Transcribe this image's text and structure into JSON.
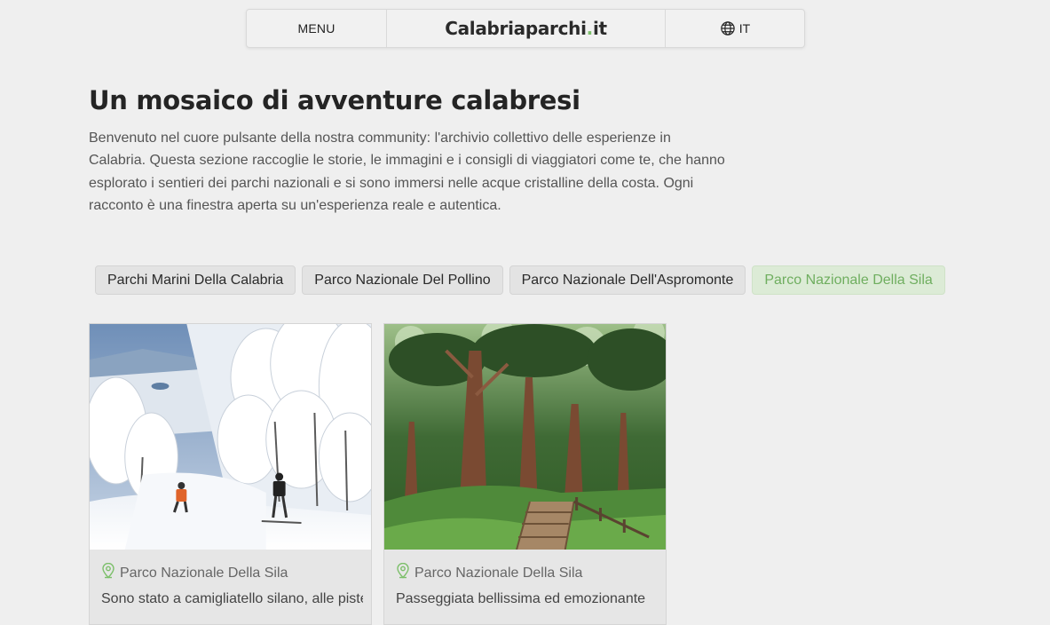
{
  "nav": {
    "menu_label": "MENU",
    "brand_name": "Calabriaparchi",
    "brand_dot": ".",
    "brand_tld": "it",
    "lang_label": "IT",
    "lang_icon": "globe-icon"
  },
  "header": {
    "title": "Un mosaico di avventure calabresi",
    "intro": "Benvenuto nel cuore pulsante della nostra community: l'archivio collettivo delle esperienze in Calabria. Questa sezione raccoglie le storie, le immagini e i consigli di viaggiatori come te, che hanno esplorato i sentieri dei parchi nazionali e si sono immersi nelle acque cristalline della costa. Ogni racconto è una finestra aperta su un'esperienza reale e autentica."
  },
  "filters": [
    {
      "label": "Parchi Marini Della Calabria",
      "active": false
    },
    {
      "label": "Parco Nazionale Del Pollino",
      "active": false
    },
    {
      "label": "Parco Nazionale Dell'Aspromonte",
      "active": false
    },
    {
      "label": "Parco Nazionale Della Sila",
      "active": true
    }
  ],
  "cards": [
    {
      "image_alt": "snowy-forest-ski-slope",
      "location": "Parco Nazionale Della Sila",
      "excerpt": "Sono stato a camigliatello silano, alle piste"
    },
    {
      "image_alt": "pine-forest-wooden-boardwalk",
      "location": "Parco Nazionale Della Sila",
      "excerpt": "Passeggiata bellissima ed emozionante"
    }
  ],
  "colors": {
    "background": "#efefef",
    "accent_green": "#7cbf6a",
    "active_chip_bg": "#dcebd6",
    "active_chip_text": "#6fae5f"
  }
}
